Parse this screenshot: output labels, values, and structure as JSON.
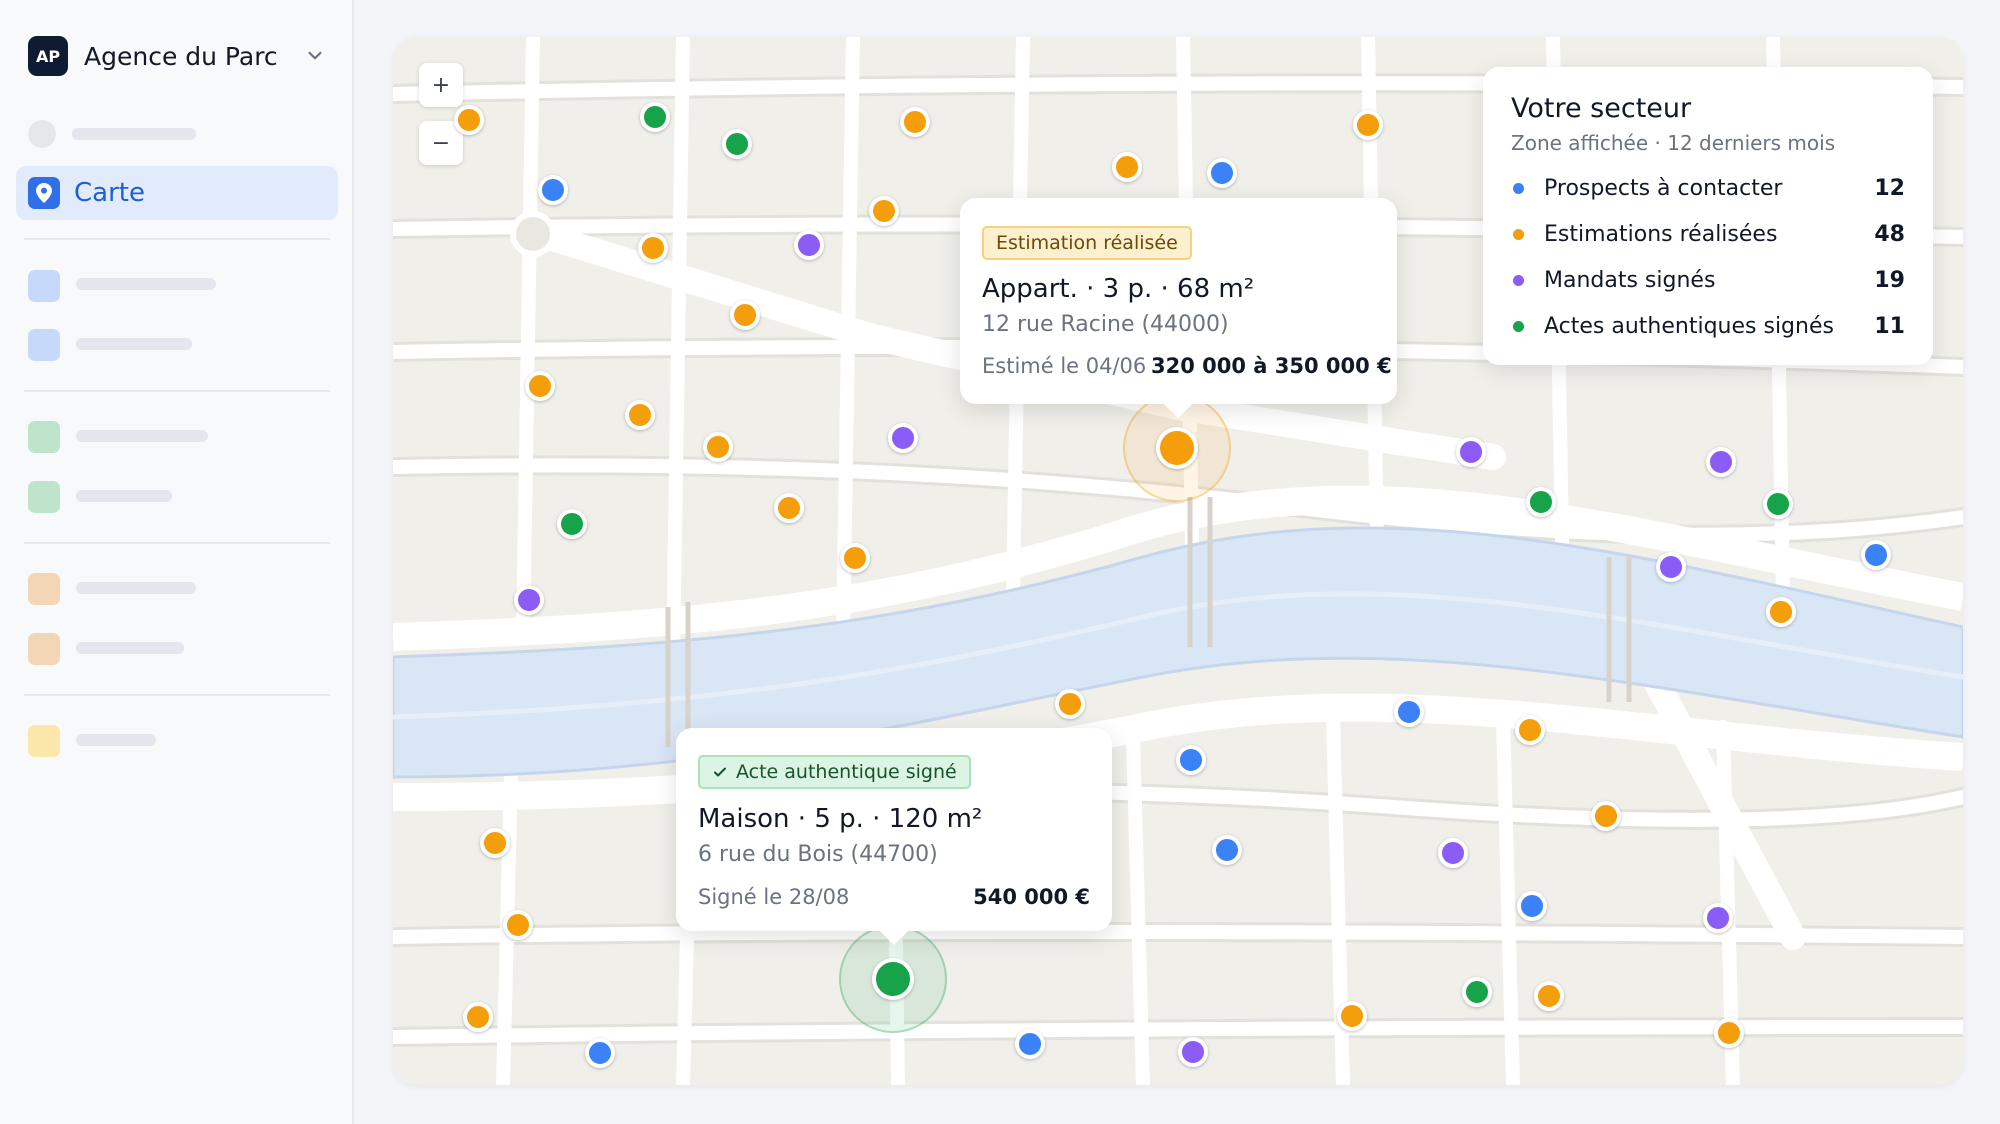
{
  "sidebar": {
    "agency_initials": "AP",
    "agency_name": "Agence du Parc",
    "active_item_label": "Carte"
  },
  "map": {
    "zoom_in": "+",
    "zoom_out": "−",
    "colors": {
      "prospect": "#3b82f6",
      "estimation": "#f59e0b",
      "mandat": "#8b5cf6",
      "acte": "#16a34a",
      "water": "#d9e6f5",
      "block": "#f0efea",
      "street": "#ffffff"
    },
    "popup_estimation": {
      "badge": "Estimation réalisée",
      "title": "Appart. · 3 p. · 68 m²",
      "address": "12 rue Racine (44000)",
      "date": "Estimé le 04/06",
      "price": "320 000 à 350 000 €"
    },
    "popup_acte": {
      "badge": "Acte authentique signé",
      "title": "Maison · 5 p. · 120 m²",
      "address": "6 rue du Bois (44700)",
      "date": "Signé le 28/08",
      "price": "540 000 €"
    }
  },
  "legend": {
    "title": "Votre secteur",
    "subtitle": "Zone affichée · 12 derniers mois",
    "items": [
      {
        "label": "Prospects à contacter",
        "count": "12",
        "color": "#3b82f6"
      },
      {
        "label": "Estimations réalisées",
        "count": "48",
        "color": "#f59e0b"
      },
      {
        "label": "Mandats signés",
        "count": "19",
        "color": "#8b5cf6"
      },
      {
        "label": "Actes authentiques signés",
        "count": "11",
        "color": "#16a34a"
      }
    ]
  }
}
